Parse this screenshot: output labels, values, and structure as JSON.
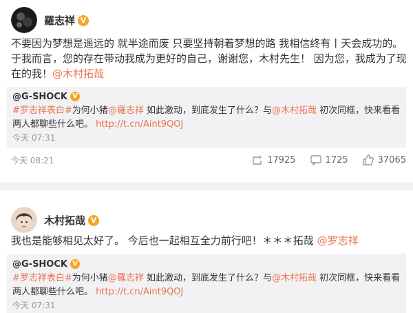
{
  "posts": [
    {
      "author": "羅志祥",
      "body": "不要因为梦想是遥远的 就半途而废 只要坚持朝着梦想的路 我相信终有丨天会成功的。 于我而言，您的存在带动我成为更好的自己，谢谢您，木村先生！ 因为您，我成为了现在的我！",
      "mention": "@木村拓哉",
      "repost": {
        "author": "@G-SHOCK",
        "hashtag": "#罗志祥表白#",
        "text1": "为何小猪",
        "mention1": "@羅志祥",
        "text2": " 如此激动，到底发生了什么？与",
        "mention2": "@木村拓哉",
        "text3": " 初次同框，快来看看两人都聊些什么吧。 ",
        "url": "http://t.cn/Aint9QOJ",
        "time": "今天 07:31"
      },
      "time": "今天 08:21",
      "reposts": "17925",
      "comments": "1725",
      "likes": "37065"
    },
    {
      "author": "木村拓哉",
      "body": "我也是能够相见太好了。 今后也一起相互全力前行吧！＊＊＊拓哉",
      "mention": "@罗志祥",
      "repost": {
        "author": "@G-SHOCK",
        "hashtag": "#罗志祥表白#",
        "text1": "为何小猪",
        "mention1": "@羅志祥",
        "text2": " 如此激动，到底发生了什么？与",
        "mention2": "@木村拓哉",
        "text3": " 初次同框，快来看看两人都聊些什么吧。 ",
        "url": "http://t.cn/Aint9QOJ",
        "time": "今天 07:31"
      }
    }
  ],
  "verified_badge": "V",
  "colors": {
    "accent": "#eb7350",
    "badge": "#f5a623",
    "repost_bg": "#f2f2f5"
  }
}
